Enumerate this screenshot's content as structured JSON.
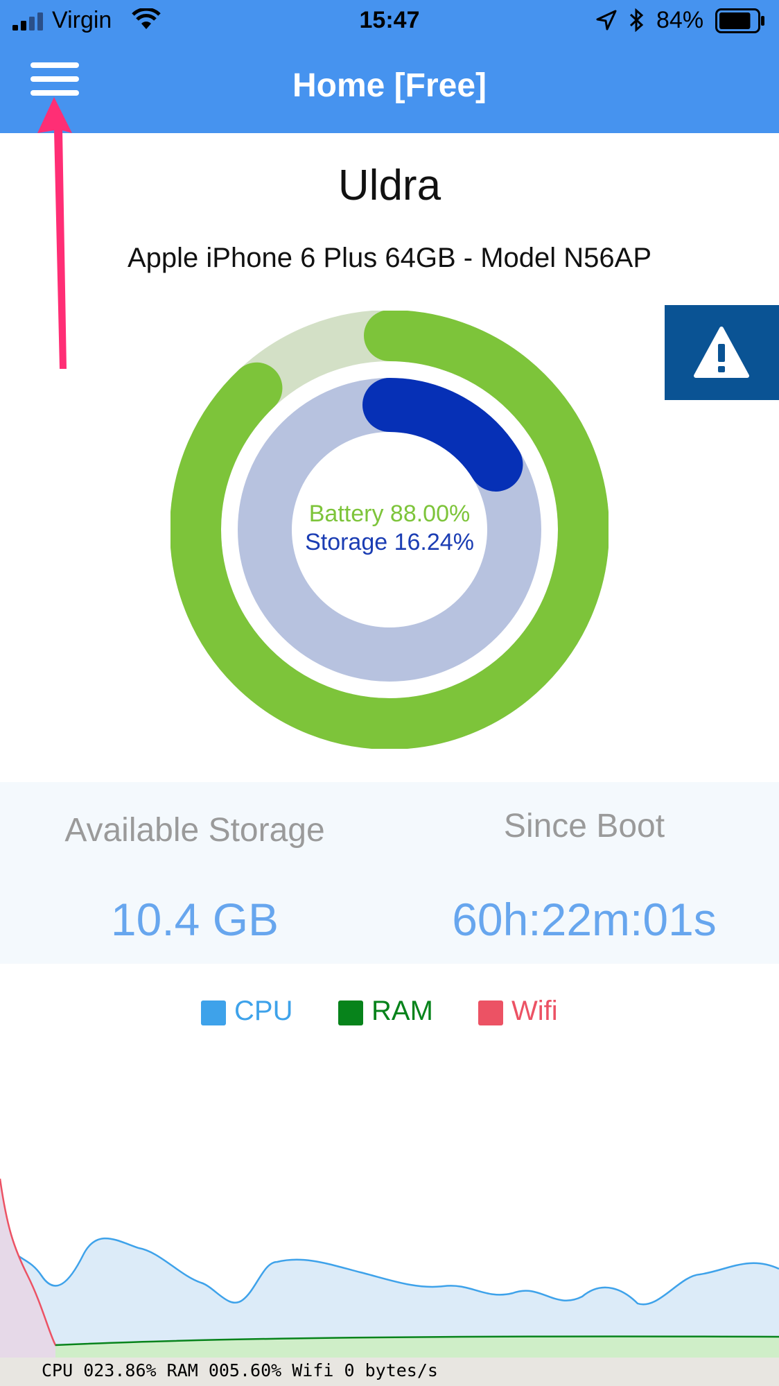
{
  "status_bar": {
    "carrier": "Virgin",
    "time": "15:47",
    "battery_percent": "84%",
    "battery_level": 0.84,
    "icons": [
      "signal-icon",
      "wifi-icon",
      "location-icon",
      "bluetooth-icon",
      "battery-icon"
    ]
  },
  "nav": {
    "title": "Home [Free]",
    "menu_icon": "hamburger-menu-icon"
  },
  "device": {
    "name": "Uldra",
    "model": "Apple iPhone 6 Plus 64GB - Model N56AP"
  },
  "warning_icon": "warning-icon",
  "rings": {
    "battery_label": "Battery 88.00%",
    "storage_label": "Storage 16.24%",
    "battery_value": 0.88,
    "storage_value": 0.1624,
    "colors": {
      "battery": "#7dc43a",
      "battery_track": "#d3e0c6",
      "storage": "#0630b6",
      "storage_track": "#b7c2df"
    }
  },
  "stats": {
    "available_storage_label": "Available Storage",
    "available_storage_value": "10.4 GB",
    "since_boot_label": "Since Boot",
    "since_boot_value": "60h:22m:01s"
  },
  "legend": {
    "cpu": "CPU",
    "ram": "RAM",
    "wifi": "Wifi",
    "colors": {
      "cpu": "#3ea2ea",
      "ram": "#07831b",
      "wifi": "#ec5264"
    }
  },
  "console_text": "CPU 023.86% RAM 005.60% Wifi 0 bytes/s",
  "colors": {
    "header": "#4693ef",
    "warning_bg": "#0a5394",
    "arrow": "#ff2e75"
  }
}
